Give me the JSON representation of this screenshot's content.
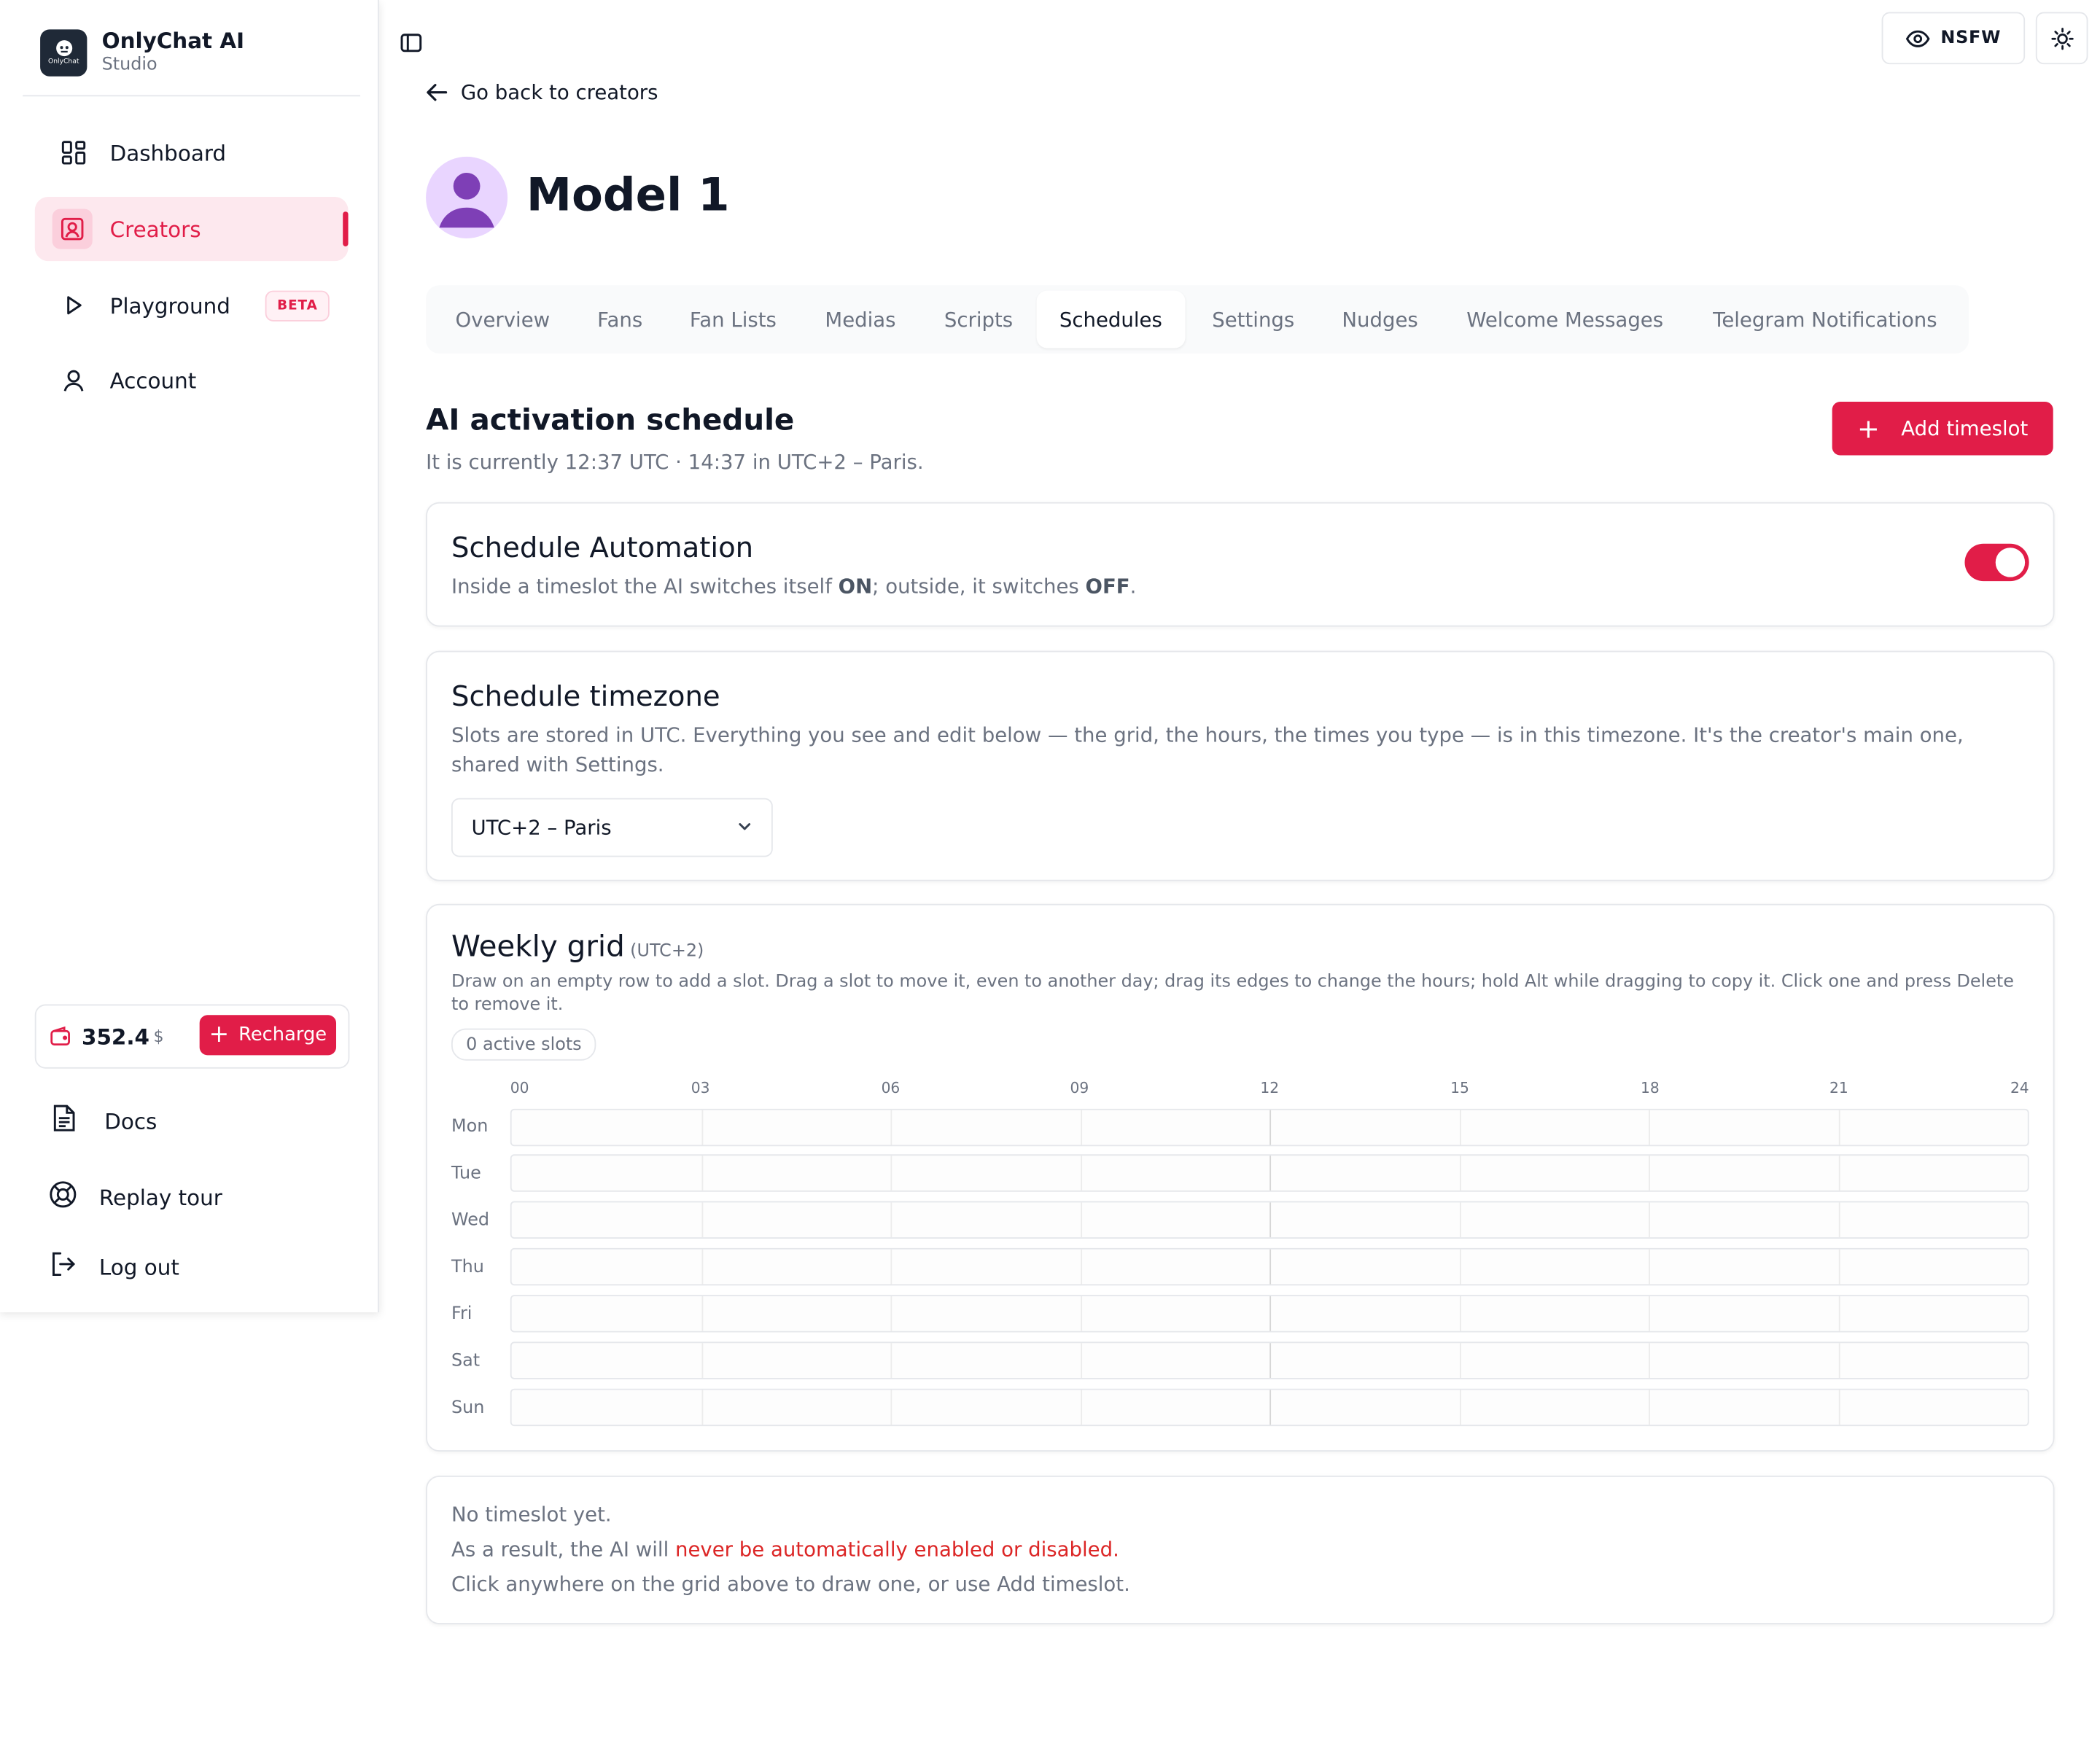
{
  "brand": {
    "title": "OnlyChat AI",
    "subtitle": "Studio",
    "logo_text": "OnlyChat"
  },
  "sidebar": {
    "items": [
      {
        "label": "Dashboard",
        "icon": "dashboard-grid-icon"
      },
      {
        "label": "Creators",
        "icon": "creator-portrait-icon",
        "active": true
      },
      {
        "label": "Playground",
        "icon": "play-icon",
        "badge": "BETA"
      },
      {
        "label": "Account",
        "icon": "user-icon"
      }
    ],
    "balance": {
      "amount": "352.4",
      "unit": "$",
      "recharge_label": "Recharge"
    },
    "footer": [
      {
        "label": "Docs",
        "icon": "document-icon"
      },
      {
        "label": "Replay tour",
        "icon": "lifebuoy-icon"
      },
      {
        "label": "Log out",
        "icon": "logout-icon"
      }
    ]
  },
  "topbar": {
    "nsfw_label": "NSFW"
  },
  "header": {
    "back_label": "Go back to creators",
    "title": "Model 1"
  },
  "tabs": [
    {
      "label": "Overview"
    },
    {
      "label": "Fans"
    },
    {
      "label": "Fan Lists"
    },
    {
      "label": "Medias"
    },
    {
      "label": "Scripts"
    },
    {
      "label": "Schedules",
      "active": true
    },
    {
      "label": "Settings"
    },
    {
      "label": "Nudges"
    },
    {
      "label": "Welcome Messages"
    },
    {
      "label": "Telegram Notifications"
    }
  ],
  "schedule": {
    "title": "AI activation schedule",
    "subtitle": "It is currently 12:37 UTC · 14:37 in UTC+2 – Paris.",
    "add_label": "Add timeslot",
    "automation": {
      "title": "Schedule Automation",
      "text_1": "Inside a timeslot the AI switches itself ",
      "on": "ON",
      "text_2": "; outside, it switches ",
      "off": "OFF",
      "text_3": ".",
      "enabled": true
    },
    "timezone": {
      "title": "Schedule timezone",
      "text": "Slots are stored in UTC. Everything you see and edit below — the grid, the hours, the times you type — is in this timezone. It's the creator's main one, shared with Settings.",
      "selected": "UTC+2 – Paris"
    },
    "grid": {
      "title": "Weekly grid",
      "tz": "(UTC+2)",
      "help": "Draw on an empty row to add a slot. Drag a slot to move it, even to another day; drag its edges to change the hours; hold Alt while dragging to copy it. Click one and press Delete to remove it.",
      "active_slots": "0 active slots",
      "hours": [
        "00",
        "03",
        "06",
        "09",
        "12",
        "15",
        "18",
        "21",
        "24"
      ],
      "days": [
        "Mon",
        "Tue",
        "Wed",
        "Thu",
        "Fri",
        "Sat",
        "Sun"
      ]
    },
    "empty": {
      "line1": "No timeslot yet.",
      "line2_a": "As a result, the AI will ",
      "line2_warn": "never be automatically enabled or disabled.",
      "line3": "Click anywhere on the grid above to draw one, or use Add timeslot."
    }
  },
  "colors": {
    "accent": "#e11d48",
    "accent_soft": "#fde8ee",
    "muted_text": "#6b7280",
    "border": "#e5e7eb"
  }
}
